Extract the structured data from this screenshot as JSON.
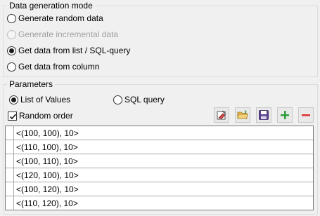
{
  "mode_group": {
    "title": "Data generation mode",
    "options": [
      {
        "label": "Generate random data",
        "checked": false,
        "disabled": false
      },
      {
        "label": "Generate incremental data",
        "checked": false,
        "disabled": true
      },
      {
        "label": "Get data from list / SQL-query",
        "checked": true,
        "disabled": false
      },
      {
        "label": "Get data from column",
        "checked": false,
        "disabled": false
      }
    ]
  },
  "params_group": {
    "title": "Parameters",
    "source_options": [
      {
        "label": "List of Values",
        "checked": true
      },
      {
        "label": "SQL query",
        "checked": false
      }
    ],
    "random_order": {
      "label": "Random order",
      "checked": true
    },
    "toolbar": [
      {
        "name": "clear-button",
        "icon": "eraser-icon"
      },
      {
        "name": "open-button",
        "icon": "folder-open-icon"
      },
      {
        "name": "save-button",
        "icon": "floppy-disk-icon"
      },
      {
        "name": "add-button",
        "icon": "plus-icon"
      },
      {
        "name": "remove-button",
        "icon": "minus-icon"
      }
    ],
    "values": [
      "<(100, 100), 10>",
      "<(110, 100), 10>",
      "<(100, 110), 10>",
      "<(120, 100), 10>",
      "<(100, 120), 10>",
      "<(110, 120), 10>"
    ]
  },
  "colors": {
    "add_green": "#2e9e3a",
    "remove_red": "#e03030",
    "folder_yellow": "#e9b84a",
    "save_purple": "#5b3f8c"
  }
}
